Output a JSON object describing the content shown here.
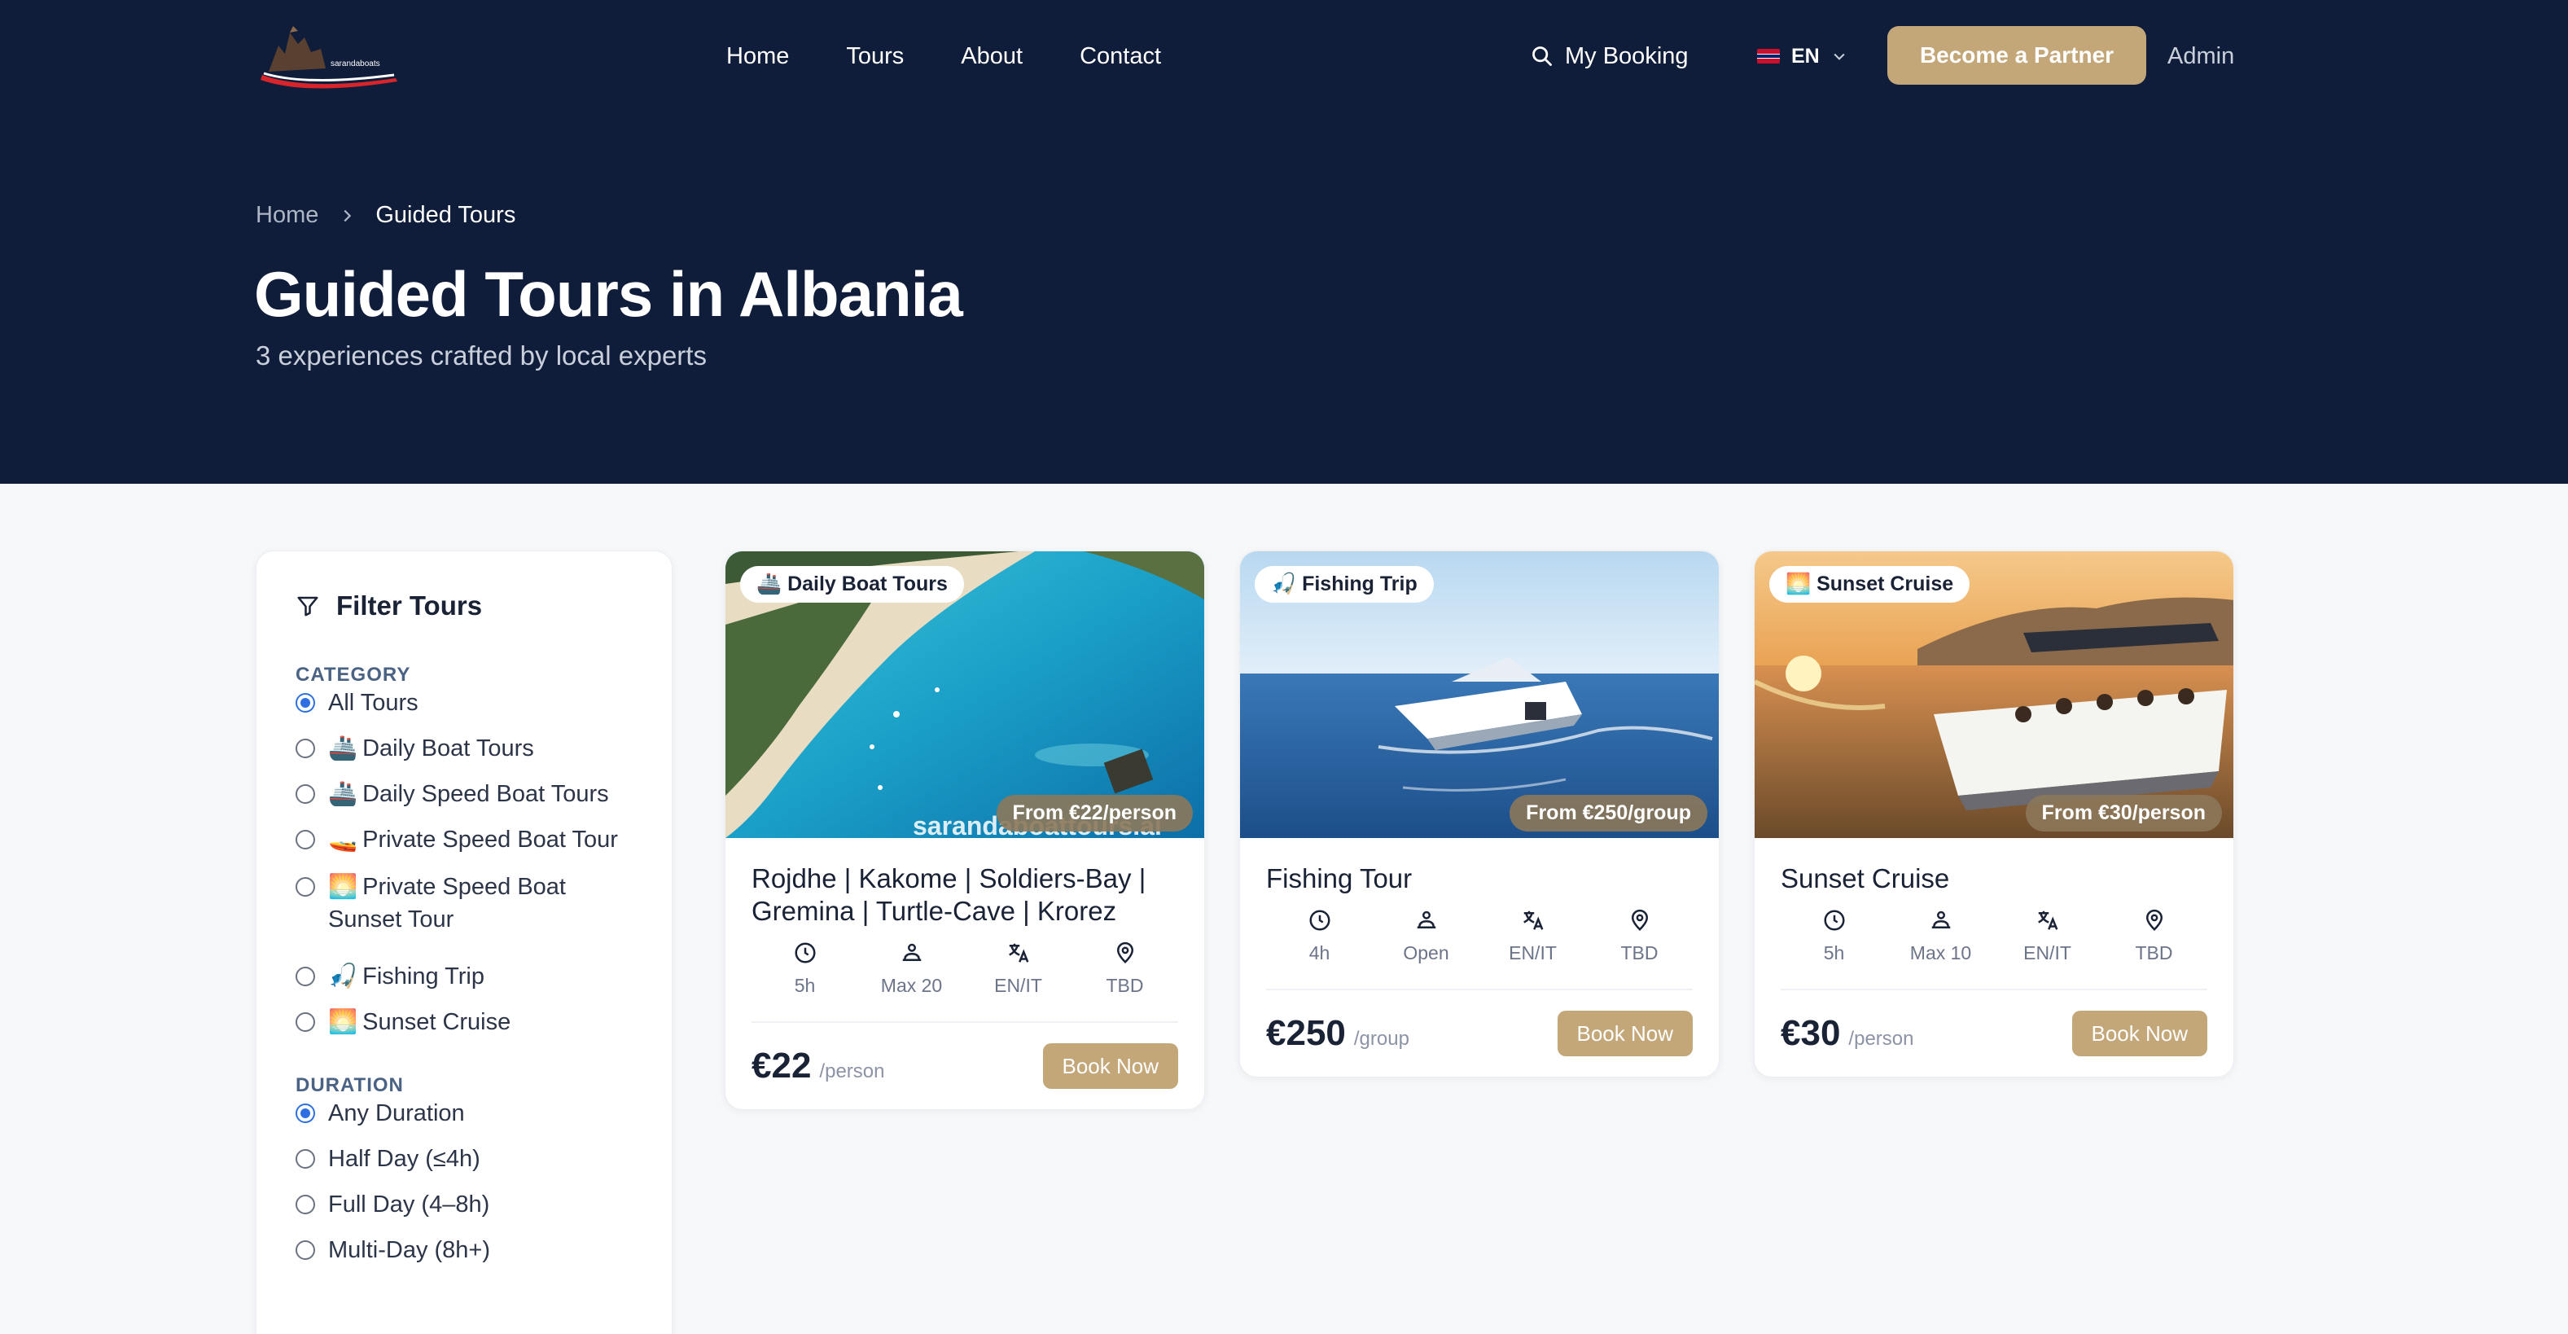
{
  "nav": {
    "logo_text": "sarandaboats",
    "links": [
      "Home",
      "Tours",
      "About",
      "Contact"
    ],
    "my_booking": "My Booking",
    "language": "EN",
    "partner_button": "Become a Partner",
    "admin": "Admin"
  },
  "hero": {
    "breadcrumb": [
      "Home",
      "Guided Tours"
    ],
    "title": "Guided Tours in Albania",
    "subtitle": "3 experiences crafted by local experts"
  },
  "filter": {
    "title": "Filter Tours",
    "category_label": "CATEGORY",
    "categories": [
      {
        "emoji": "",
        "label": "All Tours",
        "selected": true
      },
      {
        "emoji": "🚢",
        "label": "Daily Boat Tours",
        "selected": false
      },
      {
        "emoji": "🚢",
        "label": "Daily Speed Boat Tours",
        "selected": false
      },
      {
        "emoji": "🚤",
        "label": "Private Speed Boat Tour",
        "selected": false
      },
      {
        "emoji": "🌅",
        "label": "Private Speed Boat Sunset Tour",
        "selected": false
      },
      {
        "emoji": "🎣",
        "label": "Fishing Trip",
        "selected": false
      },
      {
        "emoji": "🌅",
        "label": "Sunset Cruise",
        "selected": false
      }
    ],
    "duration_label": "DURATION",
    "durations": [
      {
        "label": "Any Duration",
        "selected": true
      },
      {
        "label": "Half Day (≤4h)",
        "selected": false
      },
      {
        "label": "Full Day (4–8h)",
        "selected": false
      },
      {
        "label": "Multi-Day (8h+)",
        "selected": false
      }
    ]
  },
  "cards": [
    {
      "badge": "🚢 Daily Boat Tours",
      "price_badge": "From €22/person",
      "watermark": "sarandaboattours.al",
      "title": "Rojdhe | Kakome | Soldiers-Bay | Gremina | Turtle-Cave | Krorez",
      "duration": "5h",
      "capacity": "Max 20",
      "languages": "EN/IT",
      "location": "TBD",
      "price": "€22",
      "unit": "/person",
      "button": "Book Now"
    },
    {
      "badge": "🎣 Fishing Trip",
      "price_badge": "From €250/group",
      "title": "Fishing Tour",
      "duration": "4h",
      "capacity": "Open",
      "languages": "EN/IT",
      "location": "TBD",
      "price": "€250",
      "unit": "/group",
      "button": "Book Now"
    },
    {
      "badge": "🌅 Sunset Cruise",
      "price_badge": "From €30/person",
      "title": "Sunset Cruise",
      "duration": "5h",
      "capacity": "Max 10",
      "languages": "EN/IT",
      "location": "TBD",
      "price": "€30",
      "unit": "/person",
      "button": "Book Now"
    }
  ],
  "colors": {
    "navy": "#0f1d3a",
    "gold": "#c4a779",
    "radio_blue": "#2f6fe4"
  }
}
